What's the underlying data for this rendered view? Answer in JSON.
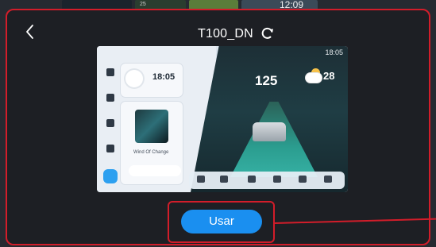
{
  "background": {
    "clock": "12:09",
    "number": "25"
  },
  "dialog": {
    "title": "T100_DN",
    "back_icon": "chevron-left-icon",
    "refresh_icon": "refresh-icon",
    "use_button_label": "Usar",
    "accent": "#1a8ff0",
    "annotation_color": "#d21d2a"
  },
  "preview": {
    "status_time": "18:05",
    "clock_time": "18:05",
    "speed": "125",
    "temperature": "28",
    "song": "Wind Of Change"
  }
}
